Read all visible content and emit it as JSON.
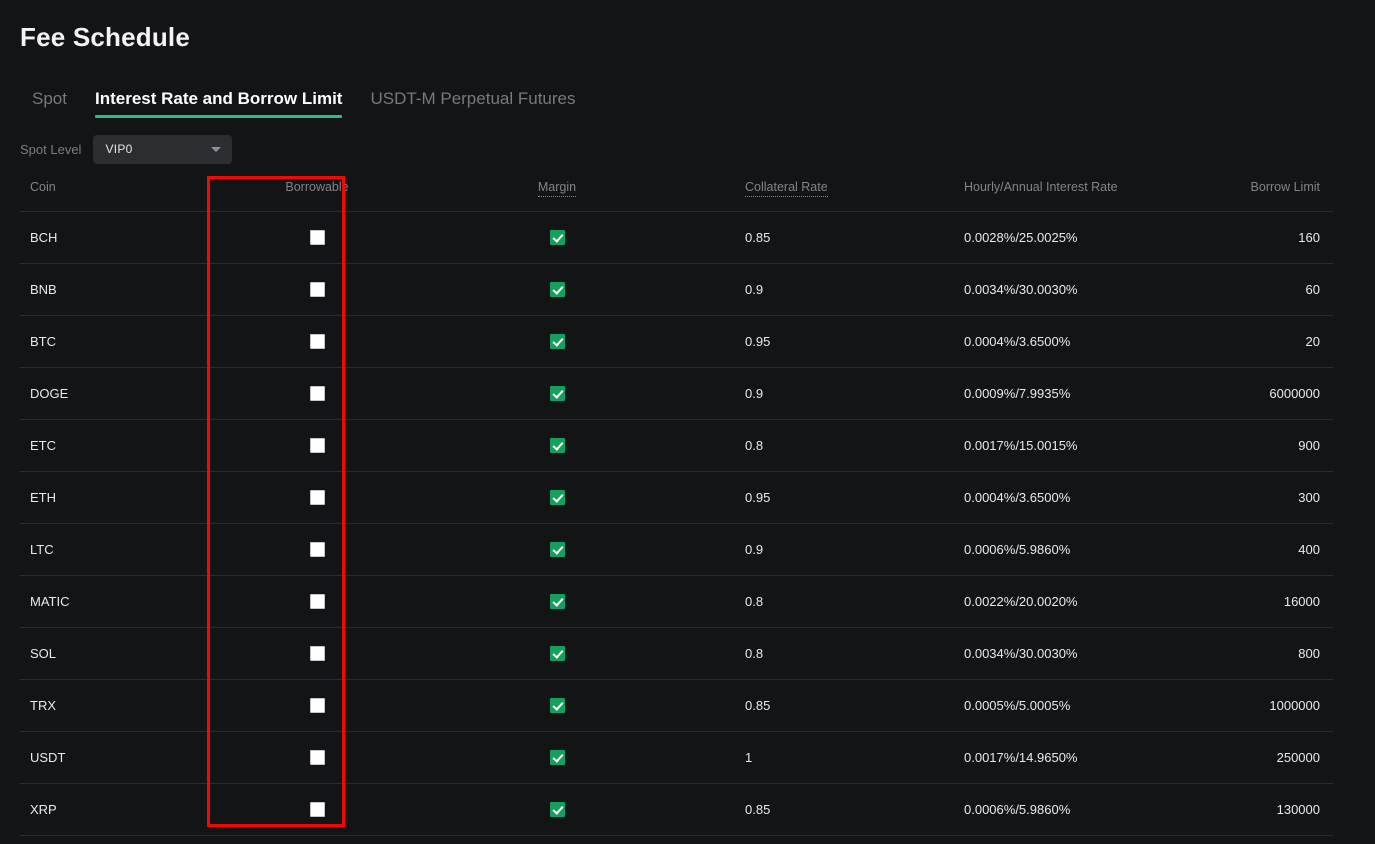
{
  "page": {
    "title": "Fee Schedule"
  },
  "tabs": [
    {
      "label": "Spot",
      "active": false
    },
    {
      "label": "Interest Rate and Borrow Limit",
      "active": true
    },
    {
      "label": "USDT-M Perpetual Futures",
      "active": false
    }
  ],
  "filter": {
    "label": "Spot Level",
    "selected": "VIP0",
    "chevron_icon": "chevron-down-icon"
  },
  "table": {
    "columns": [
      {
        "key": "coin",
        "label": "Coin",
        "tooltip": false
      },
      {
        "key": "borrowable",
        "label": "Borrowable",
        "tooltip": false
      },
      {
        "key": "margin",
        "label": "Margin",
        "tooltip": true
      },
      {
        "key": "collateral_rate",
        "label": "Collateral Rate",
        "tooltip": true
      },
      {
        "key": "interest_rate",
        "label": "Hourly/Annual Interest Rate",
        "tooltip": false
      },
      {
        "key": "borrow_limit",
        "label": "Borrow Limit",
        "tooltip": false
      }
    ],
    "rows": [
      {
        "coin": "BCH",
        "borrowable": false,
        "margin": true,
        "collateral_rate": "0.85",
        "interest_rate": "0.0028%/25.0025%",
        "borrow_limit": "160"
      },
      {
        "coin": "BNB",
        "borrowable": false,
        "margin": true,
        "collateral_rate": "0.9",
        "interest_rate": "0.0034%/30.0030%",
        "borrow_limit": "60"
      },
      {
        "coin": "BTC",
        "borrowable": false,
        "margin": true,
        "collateral_rate": "0.95",
        "interest_rate": "0.0004%/3.6500%",
        "borrow_limit": "20"
      },
      {
        "coin": "DOGE",
        "borrowable": false,
        "margin": true,
        "collateral_rate": "0.9",
        "interest_rate": "0.0009%/7.9935%",
        "borrow_limit": "6000000"
      },
      {
        "coin": "ETC",
        "borrowable": false,
        "margin": true,
        "collateral_rate": "0.8",
        "interest_rate": "0.0017%/15.0015%",
        "borrow_limit": "900"
      },
      {
        "coin": "ETH",
        "borrowable": false,
        "margin": true,
        "collateral_rate": "0.95",
        "interest_rate": "0.0004%/3.6500%",
        "borrow_limit": "300"
      },
      {
        "coin": "LTC",
        "borrowable": false,
        "margin": true,
        "collateral_rate": "0.9",
        "interest_rate": "0.0006%/5.9860%",
        "borrow_limit": "400"
      },
      {
        "coin": "MATIC",
        "borrowable": false,
        "margin": true,
        "collateral_rate": "0.8",
        "interest_rate": "0.0022%/20.0020%",
        "borrow_limit": "16000"
      },
      {
        "coin": "SOL",
        "borrowable": false,
        "margin": true,
        "collateral_rate": "0.8",
        "interest_rate": "0.0034%/30.0030%",
        "borrow_limit": "800"
      },
      {
        "coin": "TRX",
        "borrowable": false,
        "margin": true,
        "collateral_rate": "0.85",
        "interest_rate": "0.0005%/5.0005%",
        "borrow_limit": "1000000"
      },
      {
        "coin": "USDT",
        "borrowable": false,
        "margin": true,
        "collateral_rate": "1",
        "interest_rate": "0.0017%/14.9650%",
        "borrow_limit": "250000"
      },
      {
        "coin": "XRP",
        "borrowable": false,
        "margin": true,
        "collateral_rate": "0.85",
        "interest_rate": "0.0006%/5.9860%",
        "borrow_limit": "130000"
      }
    ]
  },
  "annotation": {
    "name": "borrowable-column-highlight",
    "color": "#f30707"
  },
  "colors": {
    "background": "#131416",
    "accent_green": "#2ebd85",
    "check_green": "#13a05e",
    "text_primary": "#e9eaec",
    "text_muted": "#81848a",
    "row_border": "#2a2b2d"
  }
}
